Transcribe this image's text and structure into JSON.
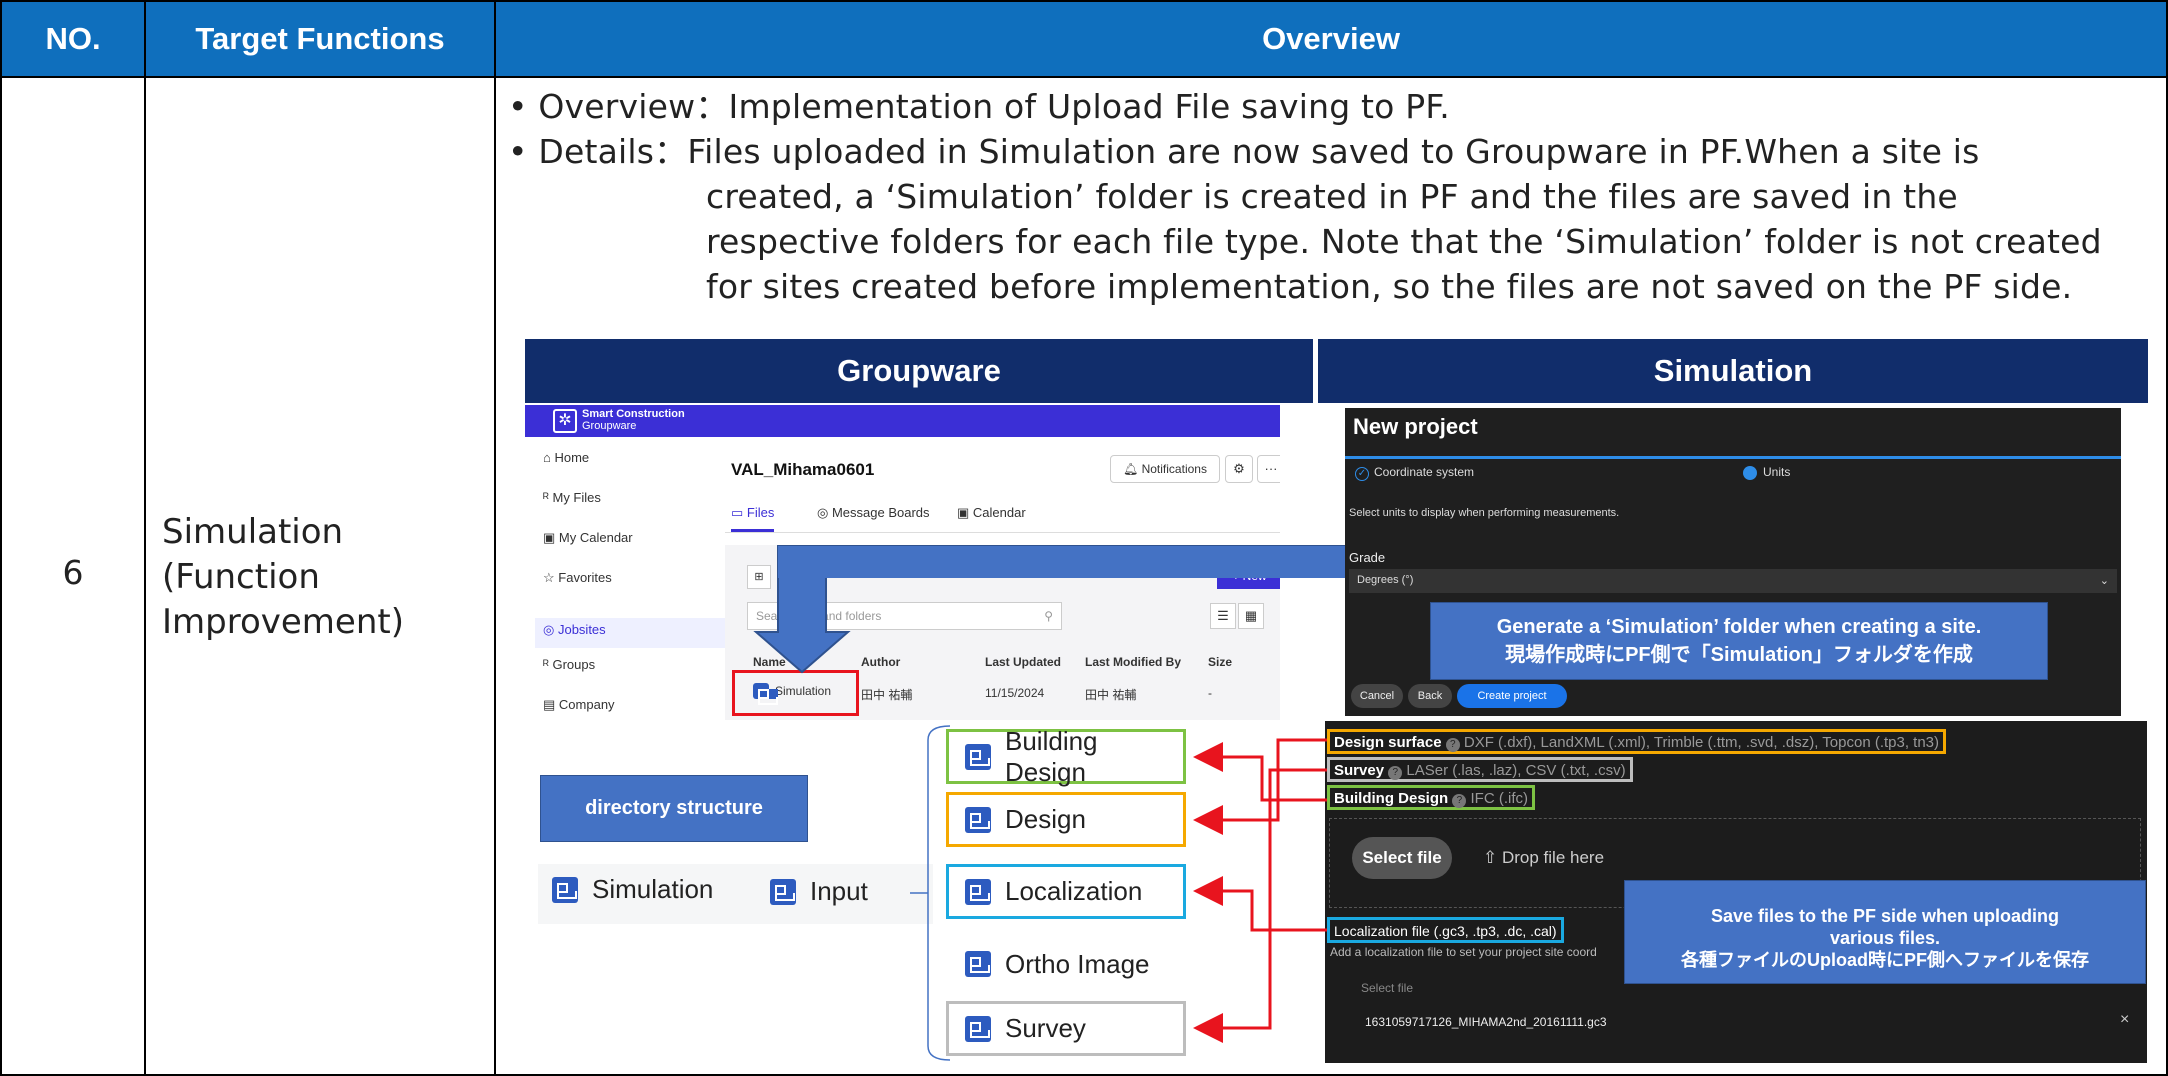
{
  "header": {
    "no": "NO.",
    "target": "Target Functions",
    "overview": "Overview"
  },
  "row": {
    "no": "6",
    "target_lines": [
      "Simulation",
      "(Function",
      "Improvement)"
    ]
  },
  "overview": {
    "line1_label": "• Overview：",
    "line1_text": "Implementation of Upload File saving to PF.",
    "line2_label": "• Details：",
    "line2_text": "Files uploaded in Simulation are now saved to Groupware in PF.When a site is",
    "line3": "created, a ‘Simulation’ folder is created in PF and the files are saved in the",
    "line4": "respective folders for each file type. Note that the ‘Simulation’ folder is not created",
    "line5": "for sites created before implementation, so the files are not saved on the PF side."
  },
  "banners": {
    "left": "Groupware",
    "right": "Simulation"
  },
  "groupware": {
    "brand_line1": "Smart Construction",
    "brand_line2": "Groupware",
    "nav": [
      "Home",
      "My Files",
      "My Calendar",
      "Favorites",
      "Jobsites",
      "Groups",
      "Company"
    ],
    "site_title": "VAL_Mihama0601",
    "notifications": "Notifications",
    "more": "···",
    "tabs": [
      "Files",
      "Message Boards",
      "Calendar"
    ],
    "new_label": "+ New",
    "search_placeholder": "Search files and folders",
    "columns": [
      "Name",
      "Author",
      "Last Updated",
      "Last Modified By",
      "Size"
    ],
    "row": {
      "name": "Simulation",
      "author": "田中 祐輔",
      "updated": "11/15/2024",
      "modified_by": "田中 祐輔",
      "size": "-"
    }
  },
  "directory": {
    "label": "directory structure",
    "root": "Simulation",
    "input": "Input",
    "folders": [
      "Building Design",
      "Design",
      "Localization",
      "Ortho Image",
      "Survey"
    ]
  },
  "sim_top": {
    "title": "New project",
    "step1": "Coordinate system",
    "step2": "Units",
    "desc": "Select units to display when performing measurements.",
    "grade_label": "Grade",
    "grade_value": "Degrees (°)",
    "cancel": "Cancel",
    "back": "Back",
    "create": "Create project"
  },
  "callout1": {
    "en": "Generate a ‘Simulation’ folder when creating a site.",
    "jp": "現場作成時にPF側で「Simulation」フォルダを作成"
  },
  "sim_files": {
    "design_surface_label": "Design surface",
    "design_surface_types": "DXF (.dxf), LandXML (.xml), Trimble (.ttm, .svd, .dsz), Topcon (.tp3, tn3)",
    "survey_label": "Survey",
    "survey_types": "LASer (.las, .laz), CSV (.txt, .csv)",
    "building_label": "Building Design",
    "building_types": "IFC (.ifc)",
    "select_file": "Select file",
    "drop_file": "Drop file here",
    "localization_label": "Localization file (.gc3, .tp3, .dc, .cal)",
    "localization_desc": "Add a localization file to set your project site coord",
    "select_file2": "Select file",
    "file_name": "1631059717126_MIHAMA2nd_20161111.gc3",
    "close": "×"
  },
  "callout2": {
    "line1": "Save files to the PF side when uploading",
    "line2": "various files.",
    "jp": "各種ファイルのUpload時にPF側へファイルを保存"
  },
  "colors": {
    "header": "#0f6fbd",
    "banner": "#112d6b",
    "callout": "#4472c4",
    "red": "#e8141e",
    "green": "#7dc243",
    "orange": "#f5a800",
    "cyan": "#1aa9e0",
    "gray": "#bdbdbd"
  }
}
